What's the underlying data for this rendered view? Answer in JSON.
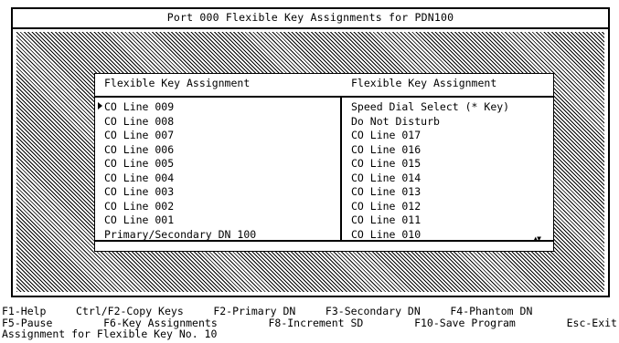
{
  "title": "Port 000 Flexible Key Assignments for PDN100",
  "columns": {
    "left_header": "Flexible Key Assignment",
    "right_header": "Flexible Key Assignment"
  },
  "left_list": [
    "CO Line 009",
    "CO Line 008",
    "CO Line 007",
    "CO Line 006",
    "CO Line 005",
    "CO Line 004",
    "CO Line 003",
    "CO Line 002",
    "CO Line 001",
    "Primary/Secondary DN  100"
  ],
  "right_list": [
    "Speed Dial Select (* Key)",
    "Do Not Disturb",
    "CO Line 017",
    "CO Line 016",
    "CO Line 015",
    "CO Line 014",
    "CO Line 013",
    "CO Line 012",
    "CO Line 011",
    "CO Line 010"
  ],
  "scroll_indicator": "▲▼",
  "function_keys": {
    "row1": [
      "F1-Help",
      "Ctrl/F2-Copy Keys",
      "F2-Primary DN",
      "F3-Secondary DN",
      "F4-Phantom DN"
    ],
    "row2": [
      "F5-Pause",
      "F6-Key Assignments",
      "F8-Increment SD",
      "F10-Save Program",
      "Esc-Exit"
    ]
  },
  "status_line": "Assignment for Flexible Key No. 10"
}
